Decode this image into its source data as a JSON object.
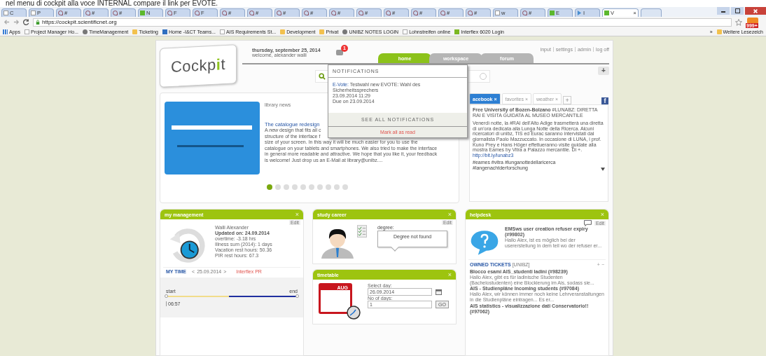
{
  "caption": "nel menu di cockpit alla voce INTERNAL compare il link per EVOTE.",
  "browser": {
    "tabs": [
      {
        "label": "C",
        "kind": "page",
        "selected": false
      },
      {
        "label": "P",
        "kind": "page",
        "selected": false
      },
      {
        "label": "#",
        "kind": "mark",
        "selected": false
      },
      {
        "label": "#",
        "kind": "mark",
        "selected": false
      },
      {
        "label": "#",
        "kind": "mark",
        "selected": false
      },
      {
        "label": "N",
        "kind": "tile",
        "selected": false
      },
      {
        "label": "F",
        "kind": "mark",
        "selected": false
      },
      {
        "label": "F",
        "kind": "mark",
        "selected": false
      },
      {
        "label": "#",
        "kind": "mark",
        "selected": false
      },
      {
        "label": "#",
        "kind": "mark",
        "selected": false
      },
      {
        "label": "#",
        "kind": "mark",
        "selected": false
      },
      {
        "label": "#",
        "kind": "mark",
        "selected": false
      },
      {
        "label": "#",
        "kind": "mark",
        "selected": false
      },
      {
        "label": "#",
        "kind": "mark",
        "selected": false
      },
      {
        "label": "#",
        "kind": "mark",
        "selected": false
      },
      {
        "label": "#",
        "kind": "mark",
        "selected": false
      },
      {
        "label": "#",
        "kind": "mark",
        "selected": false
      },
      {
        "label": "#",
        "kind": "mark",
        "selected": false
      },
      {
        "label": "w",
        "kind": "page",
        "selected": false
      },
      {
        "label": "#",
        "kind": "mark",
        "selected": false
      },
      {
        "label": "E",
        "kind": "tile",
        "selected": false
      },
      {
        "label": "I",
        "kind": "play",
        "selected": false
      },
      {
        "label": "V",
        "kind": "tile",
        "selected": true
      }
    ],
    "tab_close": "×",
    "url": "https://cockpit.scientificnet.org",
    "rss_badge": "999+",
    "bookmarks": [
      {
        "label": "Apps",
        "kind": "apps"
      },
      {
        "label": "Project Manager Ho...",
        "kind": "page"
      },
      {
        "label": "TimeManagement",
        "kind": "globe"
      },
      {
        "label": "Ticketing",
        "kind": "folder"
      },
      {
        "label": "Home -I&CT Teams...",
        "kind": "tile",
        "color": "#2f6fc0"
      },
      {
        "label": "AIS Requirements St...",
        "kind": "page"
      },
      {
        "label": "Development",
        "kind": "folder"
      },
      {
        "label": "Privat",
        "kind": "folder"
      },
      {
        "label": "UNIBZ NOTES LOGIN",
        "kind": "globe"
      },
      {
        "label": "Lohnstreifen online",
        "kind": "page"
      },
      {
        "label": "Interflex 6020 Login",
        "kind": "tile",
        "color": "#7cb821"
      }
    ],
    "more": "»",
    "other_bookmarks": "Weitere Lesezeich"
  },
  "header": {
    "logo": {
      "before": "Cockp",
      "accent": "i",
      "after": "t"
    },
    "date": "thursday, september 25, 2014",
    "welcome": "welcome, alexander walli",
    "notification_count": "1",
    "nav": [
      {
        "label": "home",
        "selected": true
      },
      {
        "label": "workspace",
        "selected": false
      },
      {
        "label": "forum",
        "selected": false
      }
    ],
    "links": [
      "input",
      "settings",
      "admin",
      "log off"
    ],
    "add": "+"
  },
  "notifications": {
    "title": "NOTIFICATIONS",
    "items": [
      {
        "source": "E-Vote:",
        "text": "Testwahl new EVOTE: Wahl des Sicherheitssprechers",
        "time": "23.09.2014 11:29",
        "due": "Due on 23.09.2014"
      }
    ],
    "see_all": "SEE ALL NOTIFICATIONS",
    "mark_read": "Mark all as read"
  },
  "news": {
    "label": "library news",
    "title": "The catalogue redesign",
    "lines": [
      "A *new* design that fits all c",
      "structure of the interface f",
      "size of your screen. In this way it will be much easier for you to use the",
      "catalogue on your tablets and smartphones. We also tried to make the interface",
      "in general more readable and attractive. We hope that you like it, your feedback",
      "is welcome! Just drop us an E-Mail at library@unibz...."
    ],
    "dots": [
      {
        "selected": true
      },
      {
        "selected": false
      },
      {
        "selected": false
      },
      {
        "selected": false
      },
      {
        "selected": false
      },
      {
        "selected": false
      },
      {
        "selected": false
      },
      {
        "selected": false
      },
      {
        "selected": false
      },
      {
        "selected": false
      }
    ]
  },
  "social": {
    "tabs": [
      {
        "label": "acebook",
        "close": "×",
        "selected": true
      },
      {
        "label": "favorites",
        "close": "×",
        "selected": false
      },
      {
        "label": "weather",
        "close": "×",
        "selected": false
      }
    ],
    "add": "+",
    "logo": "f",
    "post_title": "**Free University of Bozen-Bolzano** #LUNABZ: DIRETTA RAI E VISITA GUIDATA AL MUSEO MERCANTILE",
    "post_text": "Venerdì notte, la #RAI dell'Alto Adige trasmetterà una diretta di un'ora dedicata alla Lunga Notte della Ricerca. Alcuni ricercatori di unibz, TIS ed Eurac saranno intervistati dal giornalista Paolo Mazzuccato. In occasione di LUNA, i prof. Kuno Prey e Hans Höger effettueranno visite guidate alla mostra Eames by Vitra a Palazzo mercantile. Di +.",
    "post_link": "http://bit.ly/lunabz3",
    "tags": "#eames #vitra #lunganottedellaricerca #langenachtderforschung"
  },
  "widgets": {
    "management": {
      "title": "my management",
      "close": "×",
      "edit": "Edit",
      "name": "Walli Alexander",
      "updated": "Updated on: 24.09.2014",
      "lines": [
        "overtime: -3.18 hrs",
        "Illness sum (2014): 1 days",
        "Vacation rest hours: 50.36",
        "PIR rest hours: 67.3"
      ],
      "my_time": "MY TIME",
      "prev": "<",
      "date": "25.09.2014",
      "next": ">",
      "interflex": "Interflex PR",
      "start": "start",
      "end": "end",
      "clock_in": "06:57"
    },
    "career": {
      "title": "study career",
      "close": "×",
      "edit": "Edit",
      "degree_label": "degree:",
      "degree": "Degree not found"
    },
    "timetable": {
      "title": "timetable",
      "close": "×",
      "month": "AUG",
      "day_label": "Select day:",
      "day": "26.09.2014",
      "days_label": "No of days:",
      "days": "1",
      "go": "GO"
    },
    "helpdesk": {
      "title": "helpdesk",
      "close": "×",
      "edit": "Edit",
      "ticket_title": "EMSws user creation refuser expiry (#99802)",
      "ticket_text": "Hallo Alex, ist es möglich bei der userersteliung in dem teil wo der refuser er...",
      "owned": "OWNED TICKETS",
      "owned_scope": "[UNIBZ]",
      "plus": "+",
      "minus": "−",
      "tickets": [
        {
          "title": "Blocco esami AIS_studenti ladini (#98239)",
          "text": "Hallo Alex, gibt es für ladinische Studenten (Bachelostudenten) eine Blockierung im Ais, sodass sie..."
        },
        {
          "title": "AIS - Studienpläne Incoming students (#97084)",
          "text": "Hallo Alex, wir können immer noch keine Lehrveranstaltungen in die Studienpläne eintragen... Es er..."
        },
        {
          "title": "AIS statistics - visualizzazione dati Conservatorio!! (#97062)"
        }
      ]
    }
  }
}
